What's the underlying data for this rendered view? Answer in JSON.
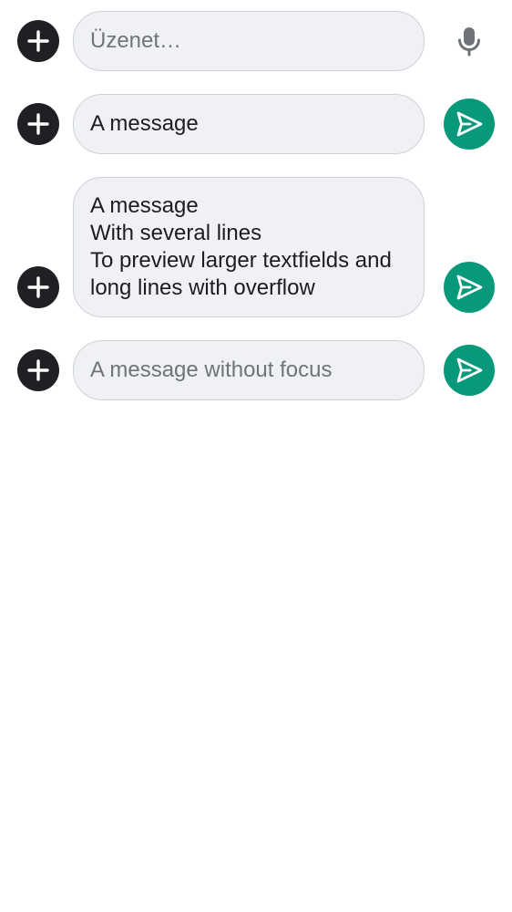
{
  "composers": [
    {
      "placeholder": "Üzenet…",
      "value": "",
      "action_icon": "microphone-icon"
    },
    {
      "placeholder": "",
      "value": "A message",
      "action_icon": "send-icon"
    },
    {
      "placeholder": "",
      "value": "A message\nWith several lines\nTo preview larger textfields and\nlong lines with overflow",
      "action_icon": "send-icon"
    },
    {
      "placeholder": "A message without focus",
      "value": "",
      "action_icon": "send-icon"
    }
  ],
  "colors": {
    "add_button_bg": "#1f2023",
    "send_button_bg": "#07997a",
    "field_bg": "#f0f1f5",
    "field_border": "#cdd0d6",
    "placeholder_text": "#70737a",
    "input_text": "#1c1d21",
    "mic_icon": "#6f7278"
  }
}
